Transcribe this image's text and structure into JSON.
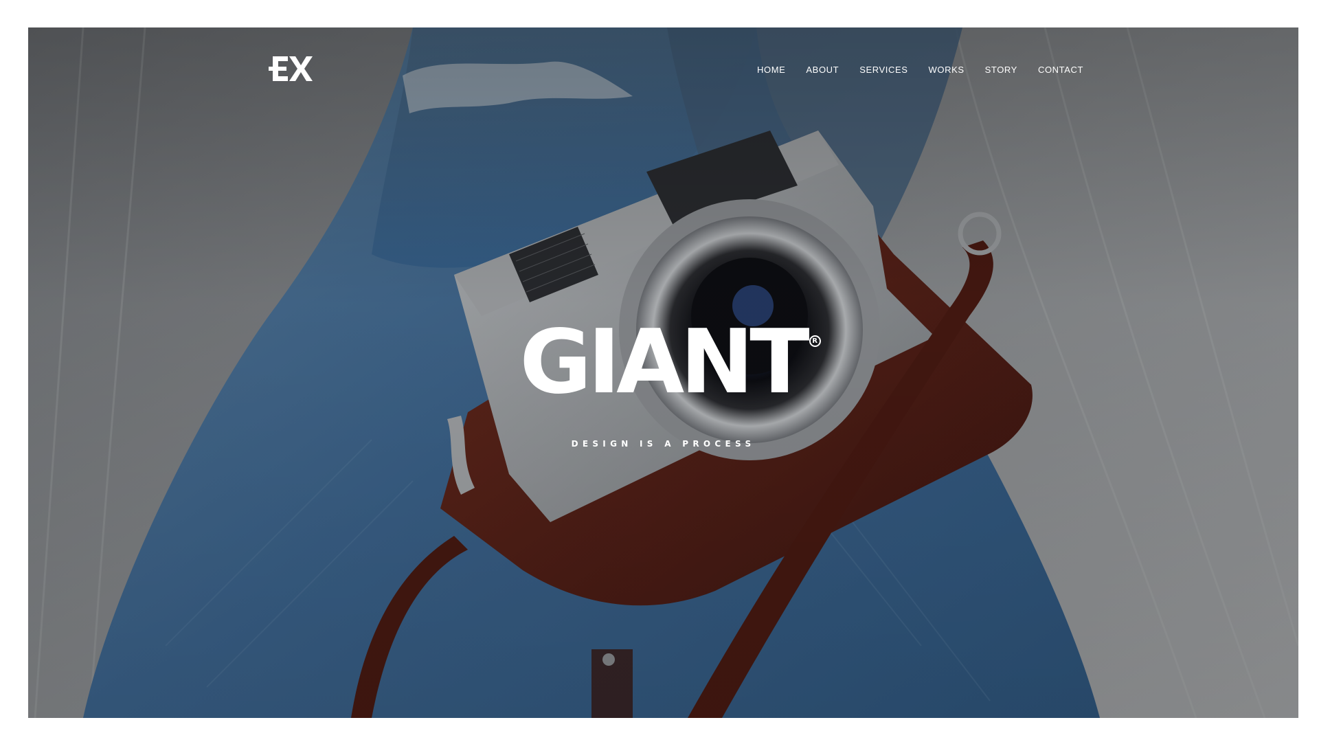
{
  "header": {
    "logo_name": "ex-logo",
    "nav": [
      {
        "label": "HOME"
      },
      {
        "label": "ABOUT"
      },
      {
        "label": "SERVICES"
      },
      {
        "label": "WORKS"
      },
      {
        "label": "STORY"
      },
      {
        "label": "CONTACT"
      }
    ]
  },
  "hero": {
    "title": "GIANT",
    "registered_mark": "R",
    "tagline": "DESIGN IS A PROCESS",
    "background_image": "camera-on-jeans-photo"
  },
  "colors": {
    "page_background": "#ffffff",
    "text": "#ffffff",
    "denim": "#3f6a93",
    "floor": "#8c8f92",
    "leather": "#5b231a"
  }
}
